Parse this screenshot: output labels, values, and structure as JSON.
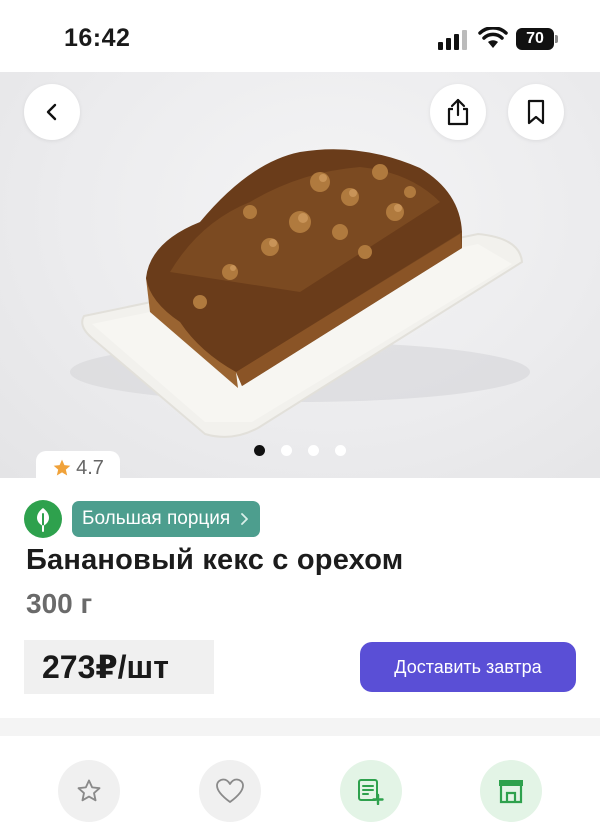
{
  "status_bar": {
    "time": "16:42",
    "battery_level": "70",
    "icons": [
      "signal-icon",
      "wifi-icon",
      "battery-icon"
    ]
  },
  "hero": {
    "image_description_icon": "product-photo",
    "carousel_dots": 4,
    "carousel_active_index": 0,
    "buttons": [
      "back-icon",
      "share-icon",
      "bookmark-icon"
    ]
  },
  "rating": {
    "value": "4.7"
  },
  "product": {
    "portion_label": "Большая порция",
    "title": "Банановый кекс с орехом",
    "weight": "300 г",
    "price": "273₽/шт",
    "deliver_button": "Доставить завтра"
  },
  "actions": [
    {
      "icon": "star-icon"
    },
    {
      "icon": "heart-icon"
    },
    {
      "icon": "add-to-list-icon"
    },
    {
      "icon": "store-icon"
    }
  ],
  "colors": {
    "primary_button": "#5a4fd6",
    "portion_chip": "#4d9e8e",
    "eco_badge": "#2ea14d",
    "rating_star": "#f0a23a",
    "action_green_bg": "#e3f4e6",
    "action_green_fg": "#2ea14d"
  }
}
